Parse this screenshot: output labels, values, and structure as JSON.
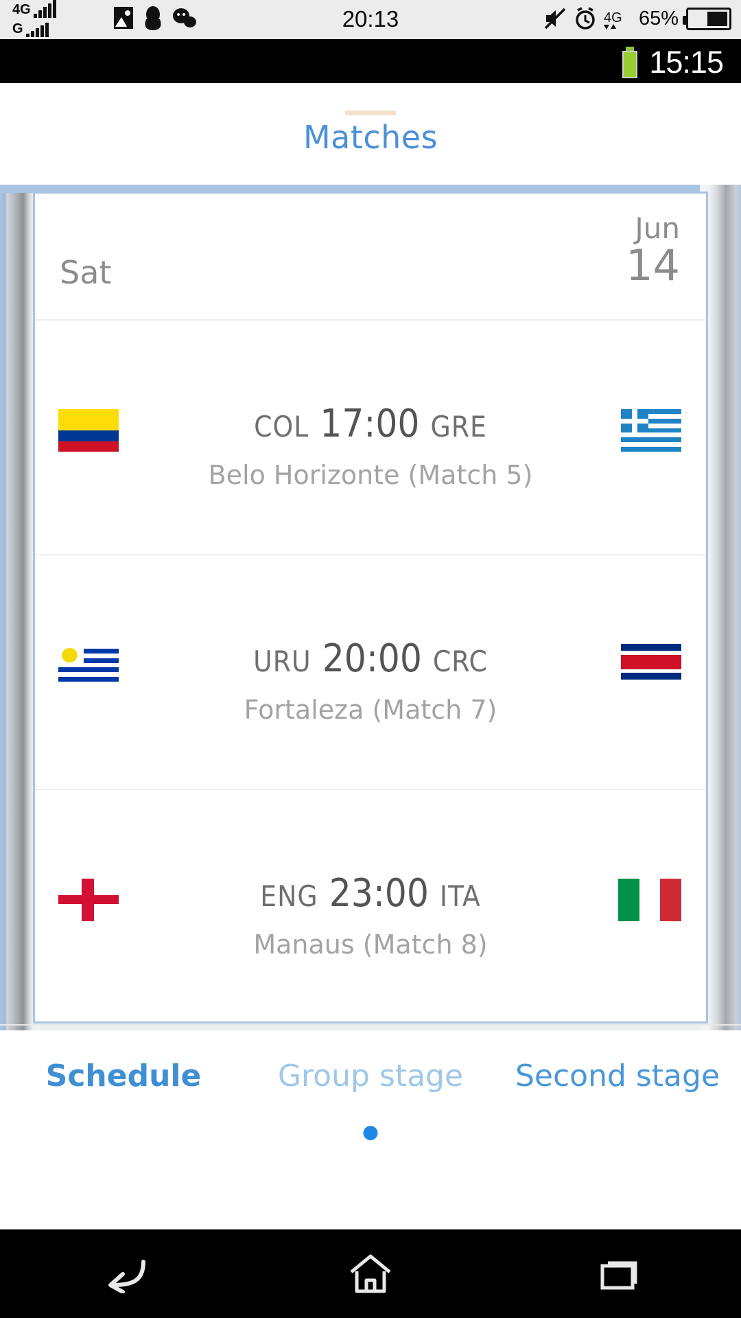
{
  "os_status_bar": {
    "network_primary": "4G",
    "network_secondary": "G",
    "clock": "20:13",
    "battery_percent": "65%",
    "icons": [
      "photo-icon",
      "penguin-icon",
      "chat-bubbles-icon",
      "mute-icon",
      "alarm-clock-icon",
      "data-transfer-4g-icon",
      "battery-icon"
    ]
  },
  "app_status_bar": {
    "clock": "15:15",
    "battery_icon": "battery-full-green-icon"
  },
  "app": {
    "title": "Matches",
    "title_color": "#4a90d9"
  },
  "schedule": {
    "date_header": {
      "day_of_week": "Sat",
      "month": "Jun",
      "day": "14"
    },
    "matches": [
      {
        "home_code": "COL",
        "time": "17:00",
        "away_code": "GRE",
        "venue": "Belo Horizonte (Match  5)",
        "home_flag": "colombia-flag-icon",
        "away_flag": "greece-flag-icon"
      },
      {
        "home_code": "URU",
        "time": "20:00",
        "away_code": "CRC",
        "venue": "Fortaleza (Match  7)",
        "home_flag": "uruguay-flag-icon",
        "away_flag": "costa-rica-flag-icon"
      },
      {
        "home_code": "ENG",
        "time": "23:00",
        "away_code": "ITA",
        "venue": "Manaus (Match  8)",
        "home_flag": "england-flag-icon",
        "away_flag": "italy-flag-icon"
      }
    ]
  },
  "bottom_tabs": [
    {
      "label": "Schedule",
      "state": "active"
    },
    {
      "label": "Group stage",
      "state": "dim"
    },
    {
      "label": "Second stage",
      "state": "normal"
    }
  ],
  "nav_bar": {
    "back": "back-icon",
    "home": "home-icon",
    "recents": "recents-icon"
  }
}
